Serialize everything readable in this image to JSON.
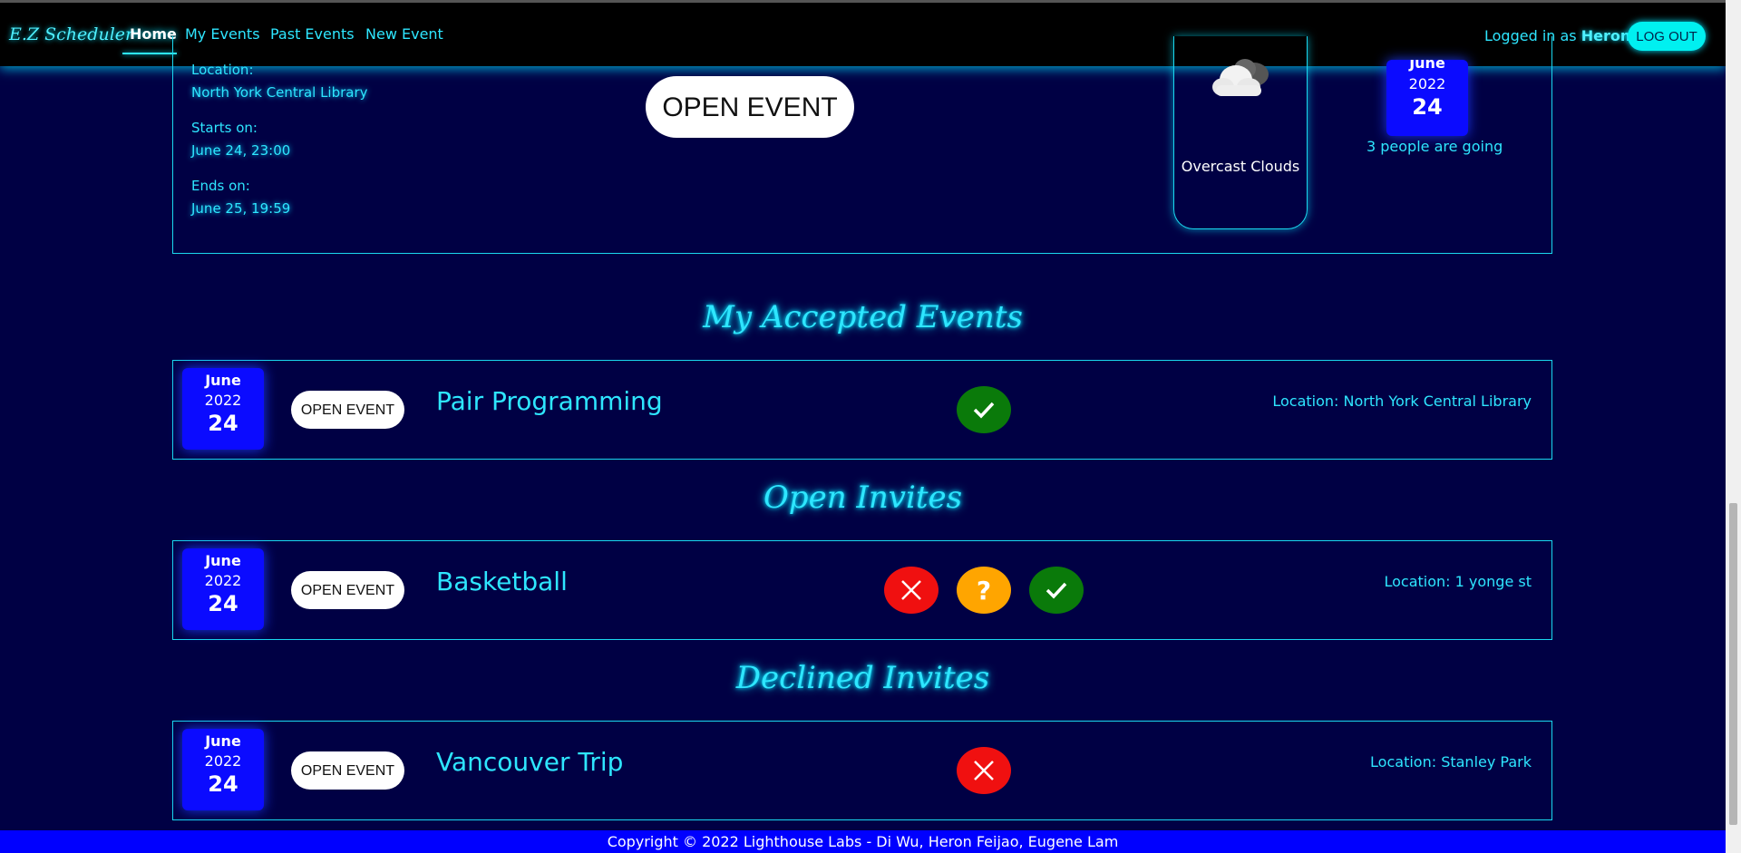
{
  "nav": {
    "brand": "E.Z Scheduler",
    "links": [
      "Home",
      "My Events",
      "Past Events",
      "New Event"
    ],
    "logged_in_prefix": "Logged in as",
    "user": "Heron",
    "logout": "LOG OUT"
  },
  "featured": {
    "location_label": "Location:",
    "location": "North York Central Library",
    "starts_label": "Starts on:",
    "starts": "June 24, 23:00",
    "ends_label": "Ends on:",
    "ends": "June 25, 19:59",
    "open_label": "OPEN EVENT",
    "weather": "Overcast Clouds",
    "weather_icon": "cloud-icon",
    "date": {
      "month": "June",
      "year": "2022",
      "day": "24"
    },
    "going": "3 people are going"
  },
  "sections": {
    "accepted": "My Accepted Events",
    "open": "Open Invites",
    "declined": "Declined Invites"
  },
  "events": {
    "accepted": {
      "month": "June",
      "year": "2022",
      "day": "24",
      "open_label": "OPEN EVENT",
      "title": "Pair Programming",
      "location": "Location: North York Central Library"
    },
    "open": {
      "month": "June",
      "year": "2022",
      "day": "24",
      "open_label": "OPEN EVENT",
      "title": "Basketball",
      "location": "Location: 1 yonge st",
      "maybe_symbol": "?"
    },
    "declined": {
      "month": "June",
      "year": "2022",
      "day": "24",
      "open_label": "OPEN EVENT",
      "title": "Vancouver Trip",
      "location": "Location: Stanley Park"
    }
  },
  "colors": {
    "background": "#000044",
    "accent": "#2ee6ff",
    "badge": "#0b0bff",
    "accept": "#0a7a0a",
    "decline": "#f01010",
    "maybe": "#ffa500"
  },
  "footer": "Copyright © 2022 Lighthouse Labs - Di Wu, Heron Feijao, Eugene Lam"
}
